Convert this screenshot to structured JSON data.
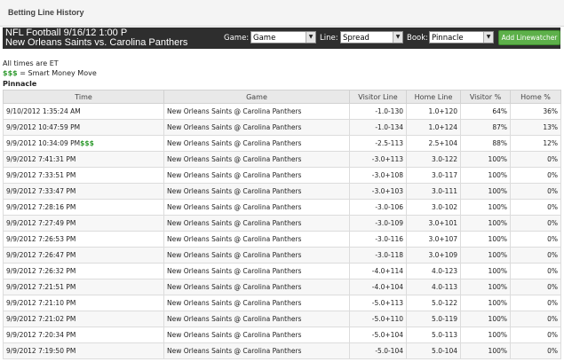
{
  "page_title": "Betting Line History",
  "header": {
    "title_line1": "NFL Football 9/16/12 1:00 P",
    "title_line2": "New Orleans Saints vs. Carolina Panthers",
    "game_label": "Game:",
    "game_value": "Game",
    "line_label": "Line:",
    "line_value": "Spread",
    "book_label": "Book:",
    "book_value": "Pinnacle",
    "add_button": "Add Linewatcher"
  },
  "notes": {
    "times": "All times are ET",
    "smart_symbol": "$$$",
    "smart_text": " = Smart Money Move"
  },
  "book_name": "Pinnacle",
  "table": {
    "columns": [
      "Time",
      "Game",
      "Visitor Line",
      "Home Line",
      "Visitor %",
      "Home %"
    ],
    "rows": [
      {
        "time": "9/10/2012 1:35:24 AM",
        "flag": "",
        "game": "New Orleans Saints @ Carolina Panthers",
        "visitor_line": "-1.0-130",
        "home_line": "1.0+120",
        "visitor_pct": "64%",
        "home_pct": "36%"
      },
      {
        "time": "9/9/2012 10:47:59 PM",
        "flag": "",
        "game": "New Orleans Saints @ Carolina Panthers",
        "visitor_line": "-1.0-134",
        "home_line": "1.0+124",
        "visitor_pct": "87%",
        "home_pct": "13%"
      },
      {
        "time": "9/9/2012 10:34:09 PM",
        "flag": "$$$",
        "game": "New Orleans Saints @ Carolina Panthers",
        "visitor_line": "-2.5-113",
        "home_line": "2.5+104",
        "visitor_pct": "88%",
        "home_pct": "12%"
      },
      {
        "time": "9/9/2012 7:41:31 PM",
        "flag": "",
        "game": "New Orleans Saints @ Carolina Panthers",
        "visitor_line": "-3.0+113",
        "home_line": "3.0-122",
        "visitor_pct": "100%",
        "home_pct": "0%"
      },
      {
        "time": "9/9/2012 7:33:51 PM",
        "flag": "",
        "game": "New Orleans Saints @ Carolina Panthers",
        "visitor_line": "-3.0+108",
        "home_line": "3.0-117",
        "visitor_pct": "100%",
        "home_pct": "0%"
      },
      {
        "time": "9/9/2012 7:33:47 PM",
        "flag": "",
        "game": "New Orleans Saints @ Carolina Panthers",
        "visitor_line": "-3.0+103",
        "home_line": "3.0-111",
        "visitor_pct": "100%",
        "home_pct": "0%"
      },
      {
        "time": "9/9/2012 7:28:16 PM",
        "flag": "",
        "game": "New Orleans Saints @ Carolina Panthers",
        "visitor_line": "-3.0-106",
        "home_line": "3.0-102",
        "visitor_pct": "100%",
        "home_pct": "0%"
      },
      {
        "time": "9/9/2012 7:27:49 PM",
        "flag": "",
        "game": "New Orleans Saints @ Carolina Panthers",
        "visitor_line": "-3.0-109",
        "home_line": "3.0+101",
        "visitor_pct": "100%",
        "home_pct": "0%"
      },
      {
        "time": "9/9/2012 7:26:53 PM",
        "flag": "",
        "game": "New Orleans Saints @ Carolina Panthers",
        "visitor_line": "-3.0-116",
        "home_line": "3.0+107",
        "visitor_pct": "100%",
        "home_pct": "0%"
      },
      {
        "time": "9/9/2012 7:26:47 PM",
        "flag": "",
        "game": "New Orleans Saints @ Carolina Panthers",
        "visitor_line": "-3.0-118",
        "home_line": "3.0+109",
        "visitor_pct": "100%",
        "home_pct": "0%"
      },
      {
        "time": "9/9/2012 7:26:32 PM",
        "flag": "",
        "game": "New Orleans Saints @ Carolina Panthers",
        "visitor_line": "-4.0+114",
        "home_line": "4.0-123",
        "visitor_pct": "100%",
        "home_pct": "0%"
      },
      {
        "time": "9/9/2012 7:21:51 PM",
        "flag": "",
        "game": "New Orleans Saints @ Carolina Panthers",
        "visitor_line": "-4.0+104",
        "home_line": "4.0-113",
        "visitor_pct": "100%",
        "home_pct": "0%"
      },
      {
        "time": "9/9/2012 7:21:10 PM",
        "flag": "",
        "game": "New Orleans Saints @ Carolina Panthers",
        "visitor_line": "-5.0+113",
        "home_line": "5.0-122",
        "visitor_pct": "100%",
        "home_pct": "0%"
      },
      {
        "time": "9/9/2012 7:21:02 PM",
        "flag": "",
        "game": "New Orleans Saints @ Carolina Panthers",
        "visitor_line": "-5.0+110",
        "home_line": "5.0-119",
        "visitor_pct": "100%",
        "home_pct": "0%"
      },
      {
        "time": "9/9/2012 7:20:34 PM",
        "flag": "",
        "game": "New Orleans Saints @ Carolina Panthers",
        "visitor_line": "-5.0+104",
        "home_line": "5.0-113",
        "visitor_pct": "100%",
        "home_pct": "0%"
      },
      {
        "time": "9/9/2012 7:19:50 PM",
        "flag": "",
        "game": "New Orleans Saints @ Carolina Panthers",
        "visitor_line": "-5.0-104",
        "home_line": "5.0-104",
        "visitor_pct": "100%",
        "home_pct": "0%"
      }
    ]
  },
  "colors": {
    "header_bg": "#2e2e2e",
    "smart_money": "#2e9a2e",
    "add_button": "#5db04a"
  }
}
